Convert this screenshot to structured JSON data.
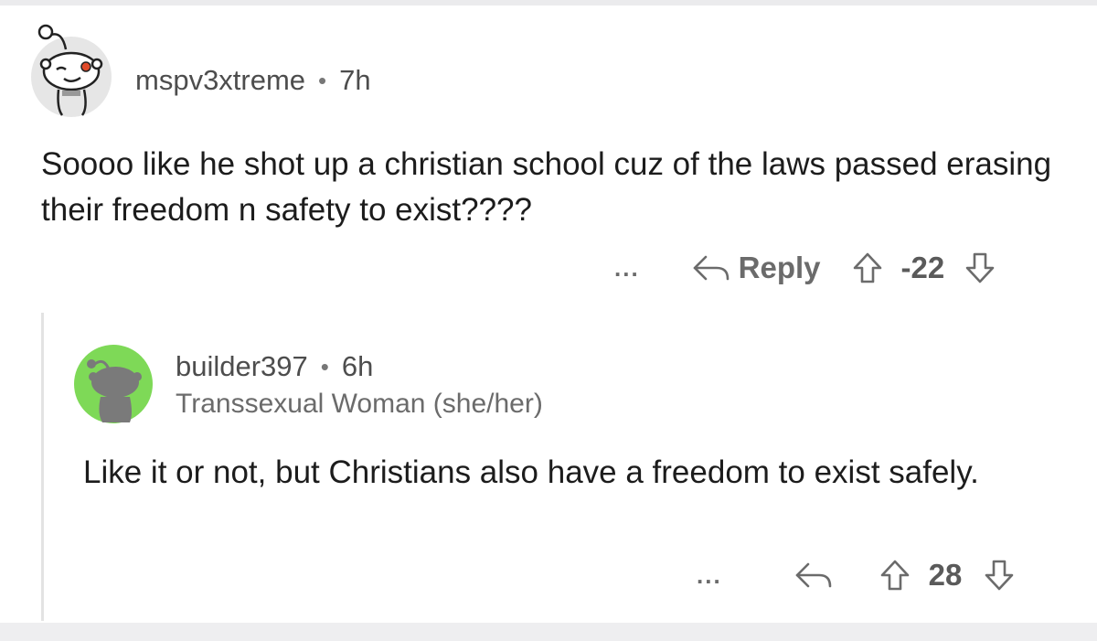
{
  "comments": [
    {
      "username": "mspv3xtreme",
      "separator": "•",
      "time": "7h",
      "text": "Soooo like he shot up a christian school cuz of the laws passed erasing their freedom n safety to exist????",
      "more": "...",
      "reply_label": "Reply",
      "score": "-22",
      "avatar_color": "#e6e6e6"
    },
    {
      "username": "builder397",
      "separator": "•",
      "time": "6h",
      "flair": "Transsexual Woman (she/her)",
      "text": "Like it or not, but Christians also have a freedom to exist safely.",
      "more": "...",
      "score": "28",
      "avatar_color": "#7ed957"
    }
  ],
  "icons": {
    "reply": "reply-arrow-icon",
    "upvote": "upvote-arrow-icon",
    "downvote": "downvote-arrow-icon",
    "more": "more-options-icon"
  },
  "colors": {
    "text": "#1c1c1c",
    "meta": "#4d4d4d",
    "actions": "#6b6b6b",
    "thread_line": "#e3e3e3"
  }
}
